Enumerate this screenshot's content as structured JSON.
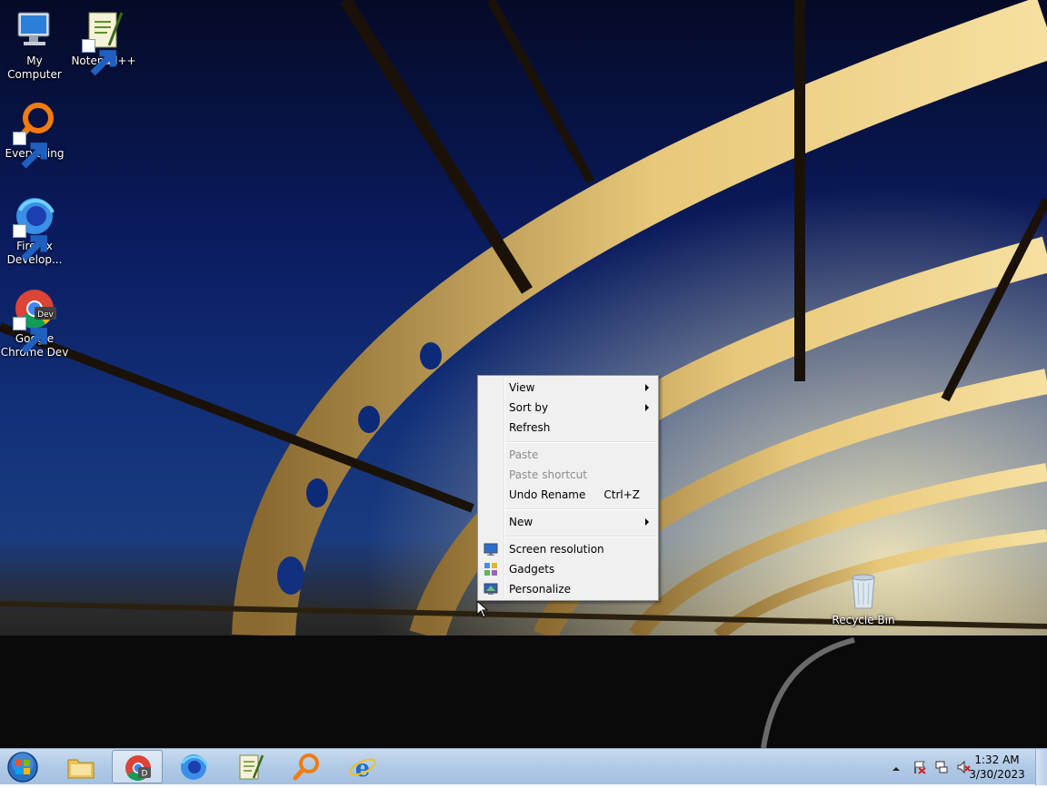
{
  "desktop": {
    "icons": [
      {
        "label": "My Computer",
        "icon": "computer-icon"
      },
      {
        "label": "Notepad++",
        "icon": "notepadpp-icon"
      },
      {
        "label": "Everything",
        "icon": "everything-search-icon"
      },
      {
        "label": "Firefox Develop...",
        "icon": "firefox-dev-icon"
      },
      {
        "label": "Google Chrome Dev",
        "icon": "chrome-dev-icon"
      },
      {
        "label": "Recycle Bin",
        "icon": "recycle-bin-icon"
      }
    ]
  },
  "context_menu": {
    "items": [
      {
        "label": "View",
        "submenu": true
      },
      {
        "label": "Sort by",
        "submenu": true
      },
      {
        "label": "Refresh"
      },
      {
        "label": "Paste",
        "disabled": true
      },
      {
        "label": "Paste shortcut",
        "disabled": true
      },
      {
        "label": "Undo Rename",
        "shortcut": "Ctrl+Z"
      },
      {
        "label": "New",
        "submenu": true
      },
      {
        "label": "Screen resolution",
        "icon": "screen-resolution-icon"
      },
      {
        "label": "Gadgets",
        "icon": "gadgets-icon"
      },
      {
        "label": "Personalize",
        "icon": "personalize-icon"
      }
    ]
  },
  "taskbar": {
    "pinned": [
      {
        "name": "windows-explorer",
        "icon": "folder-icon"
      },
      {
        "name": "chrome-dev",
        "icon": "chrome-dev-icon",
        "active": true
      },
      {
        "name": "firefox-dev",
        "icon": "firefox-dev-icon"
      },
      {
        "name": "notepadpp",
        "icon": "notepadpp-icon"
      },
      {
        "name": "everything",
        "icon": "everything-search-icon"
      },
      {
        "name": "internet-explorer",
        "icon": "ie-icon"
      }
    ],
    "tray": {
      "time": "1:32 AM",
      "date": "3/30/2023",
      "icons": [
        "show-hidden-icons-arrow",
        "action-center-flag-icon",
        "network-icon",
        "volume-muted-icon"
      ]
    }
  },
  "colors": {
    "menu_bg": "#f0f0f0",
    "taskbar": "#b2cbe6",
    "sky": "#0a1a5c"
  }
}
